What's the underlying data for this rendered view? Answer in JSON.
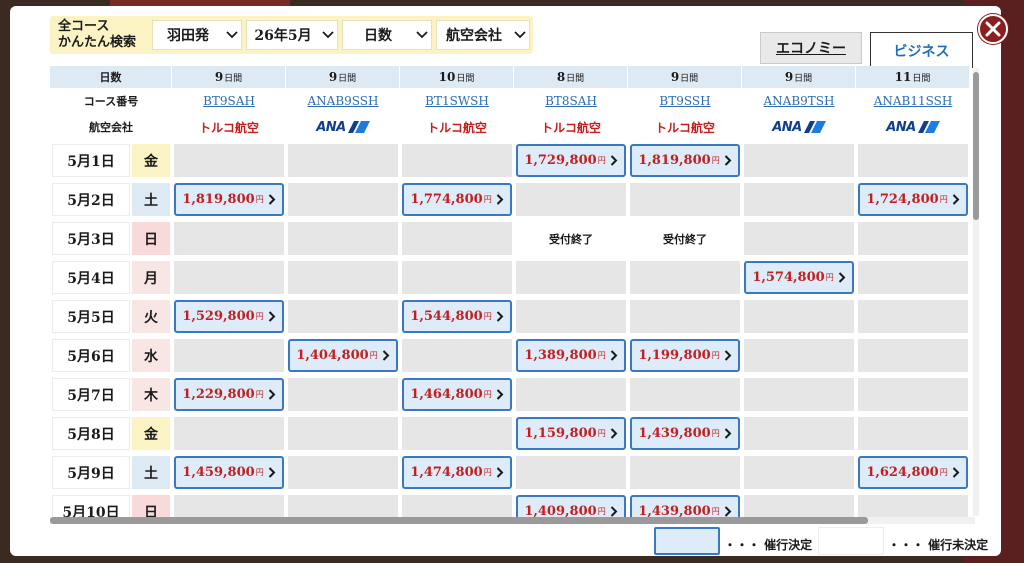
{
  "filter": {
    "title_line1": "全コース",
    "title_line2": "かんたん検索",
    "departure": "羽田発",
    "month": "26年5月",
    "days": "日数",
    "airline": "航空会社"
  },
  "tabs": {
    "economy": "エコノミー",
    "business": "ビジネス"
  },
  "headers": {
    "days_label": "日数",
    "course_label": "コース番号",
    "airline_label": "航空会社",
    "day_unit": "日間",
    "columns": [
      {
        "days": "9",
        "course": "BT9SAH",
        "airline": "トルコ航空",
        "airline_type": "turkish"
      },
      {
        "days": "9",
        "course": "ANAB9SSH",
        "airline": "ANA",
        "airline_type": "ana"
      },
      {
        "days": "10",
        "course": "BT1SWSH",
        "airline": "トルコ航空",
        "airline_type": "turkish"
      },
      {
        "days": "8",
        "course": "BT8SAH",
        "airline": "トルコ航空",
        "airline_type": "turkish"
      },
      {
        "days": "9",
        "course": "BT9SSH",
        "airline": "トルコ航空",
        "airline_type": "turkish"
      },
      {
        "days": "9",
        "course": "ANAB9TSH",
        "airline": "ANA",
        "airline_type": "ana"
      },
      {
        "days": "11",
        "course": "ANAB11SSH",
        "airline": "ANA",
        "airline_type": "ana"
      }
    ]
  },
  "yen": "円",
  "rows": [
    {
      "date": "5月1日",
      "weekday": "金",
      "wd_type": "fri",
      "cells": [
        null,
        null,
        null,
        "1,729,800",
        "1,819,800",
        null,
        null
      ]
    },
    {
      "date": "5月2日",
      "weekday": "土",
      "wd_type": "sat",
      "cells": [
        "1,819,800",
        null,
        "1,774,800",
        null,
        null,
        null,
        "1,724,800"
      ]
    },
    {
      "date": "5月3日",
      "weekday": "日",
      "wd_type": "sun",
      "cells": [
        null,
        null,
        null,
        "受付終了",
        "受付終了",
        null,
        null
      ]
    },
    {
      "date": "5月4日",
      "weekday": "月",
      "wd_type": "weekday",
      "cells": [
        null,
        null,
        null,
        null,
        null,
        "1,574,800",
        null
      ]
    },
    {
      "date": "5月5日",
      "weekday": "火",
      "wd_type": "weekday",
      "cells": [
        "1,529,800",
        null,
        "1,544,800",
        null,
        null,
        null,
        null
      ]
    },
    {
      "date": "5月6日",
      "weekday": "水",
      "wd_type": "weekday",
      "cells": [
        null,
        "1,404,800",
        null,
        "1,389,800",
        "1,199,800",
        null,
        null
      ]
    },
    {
      "date": "5月7日",
      "weekday": "木",
      "wd_type": "weekday",
      "cells": [
        "1,229,800",
        null,
        "1,464,800",
        null,
        null,
        null,
        null
      ]
    },
    {
      "date": "5月8日",
      "weekday": "金",
      "wd_type": "fri",
      "cells": [
        null,
        null,
        null,
        "1,159,800",
        "1,439,800",
        null,
        null
      ]
    },
    {
      "date": "5月9日",
      "weekday": "土",
      "wd_type": "sat",
      "cells": [
        "1,459,800",
        null,
        "1,474,800",
        null,
        null,
        null,
        "1,624,800"
      ]
    },
    {
      "date": "5月10日",
      "weekday": "日",
      "wd_type": "sun",
      "cells": [
        null,
        null,
        null,
        "1,409,800",
        "1,439,800",
        null,
        null
      ]
    }
  ],
  "closed_text": "受付終了",
  "legend": {
    "guaranteed": "・・・ 催行決定",
    "not_guaranteed": "・・・ 催行未決定"
  },
  "colors": {
    "price_red": "#c21f1f",
    "link_blue": "#2a6db5",
    "guaranteed_fill": "#ddecf8",
    "guaranteed_border": "#3a78c2",
    "close_red": "#8a1f1f"
  }
}
